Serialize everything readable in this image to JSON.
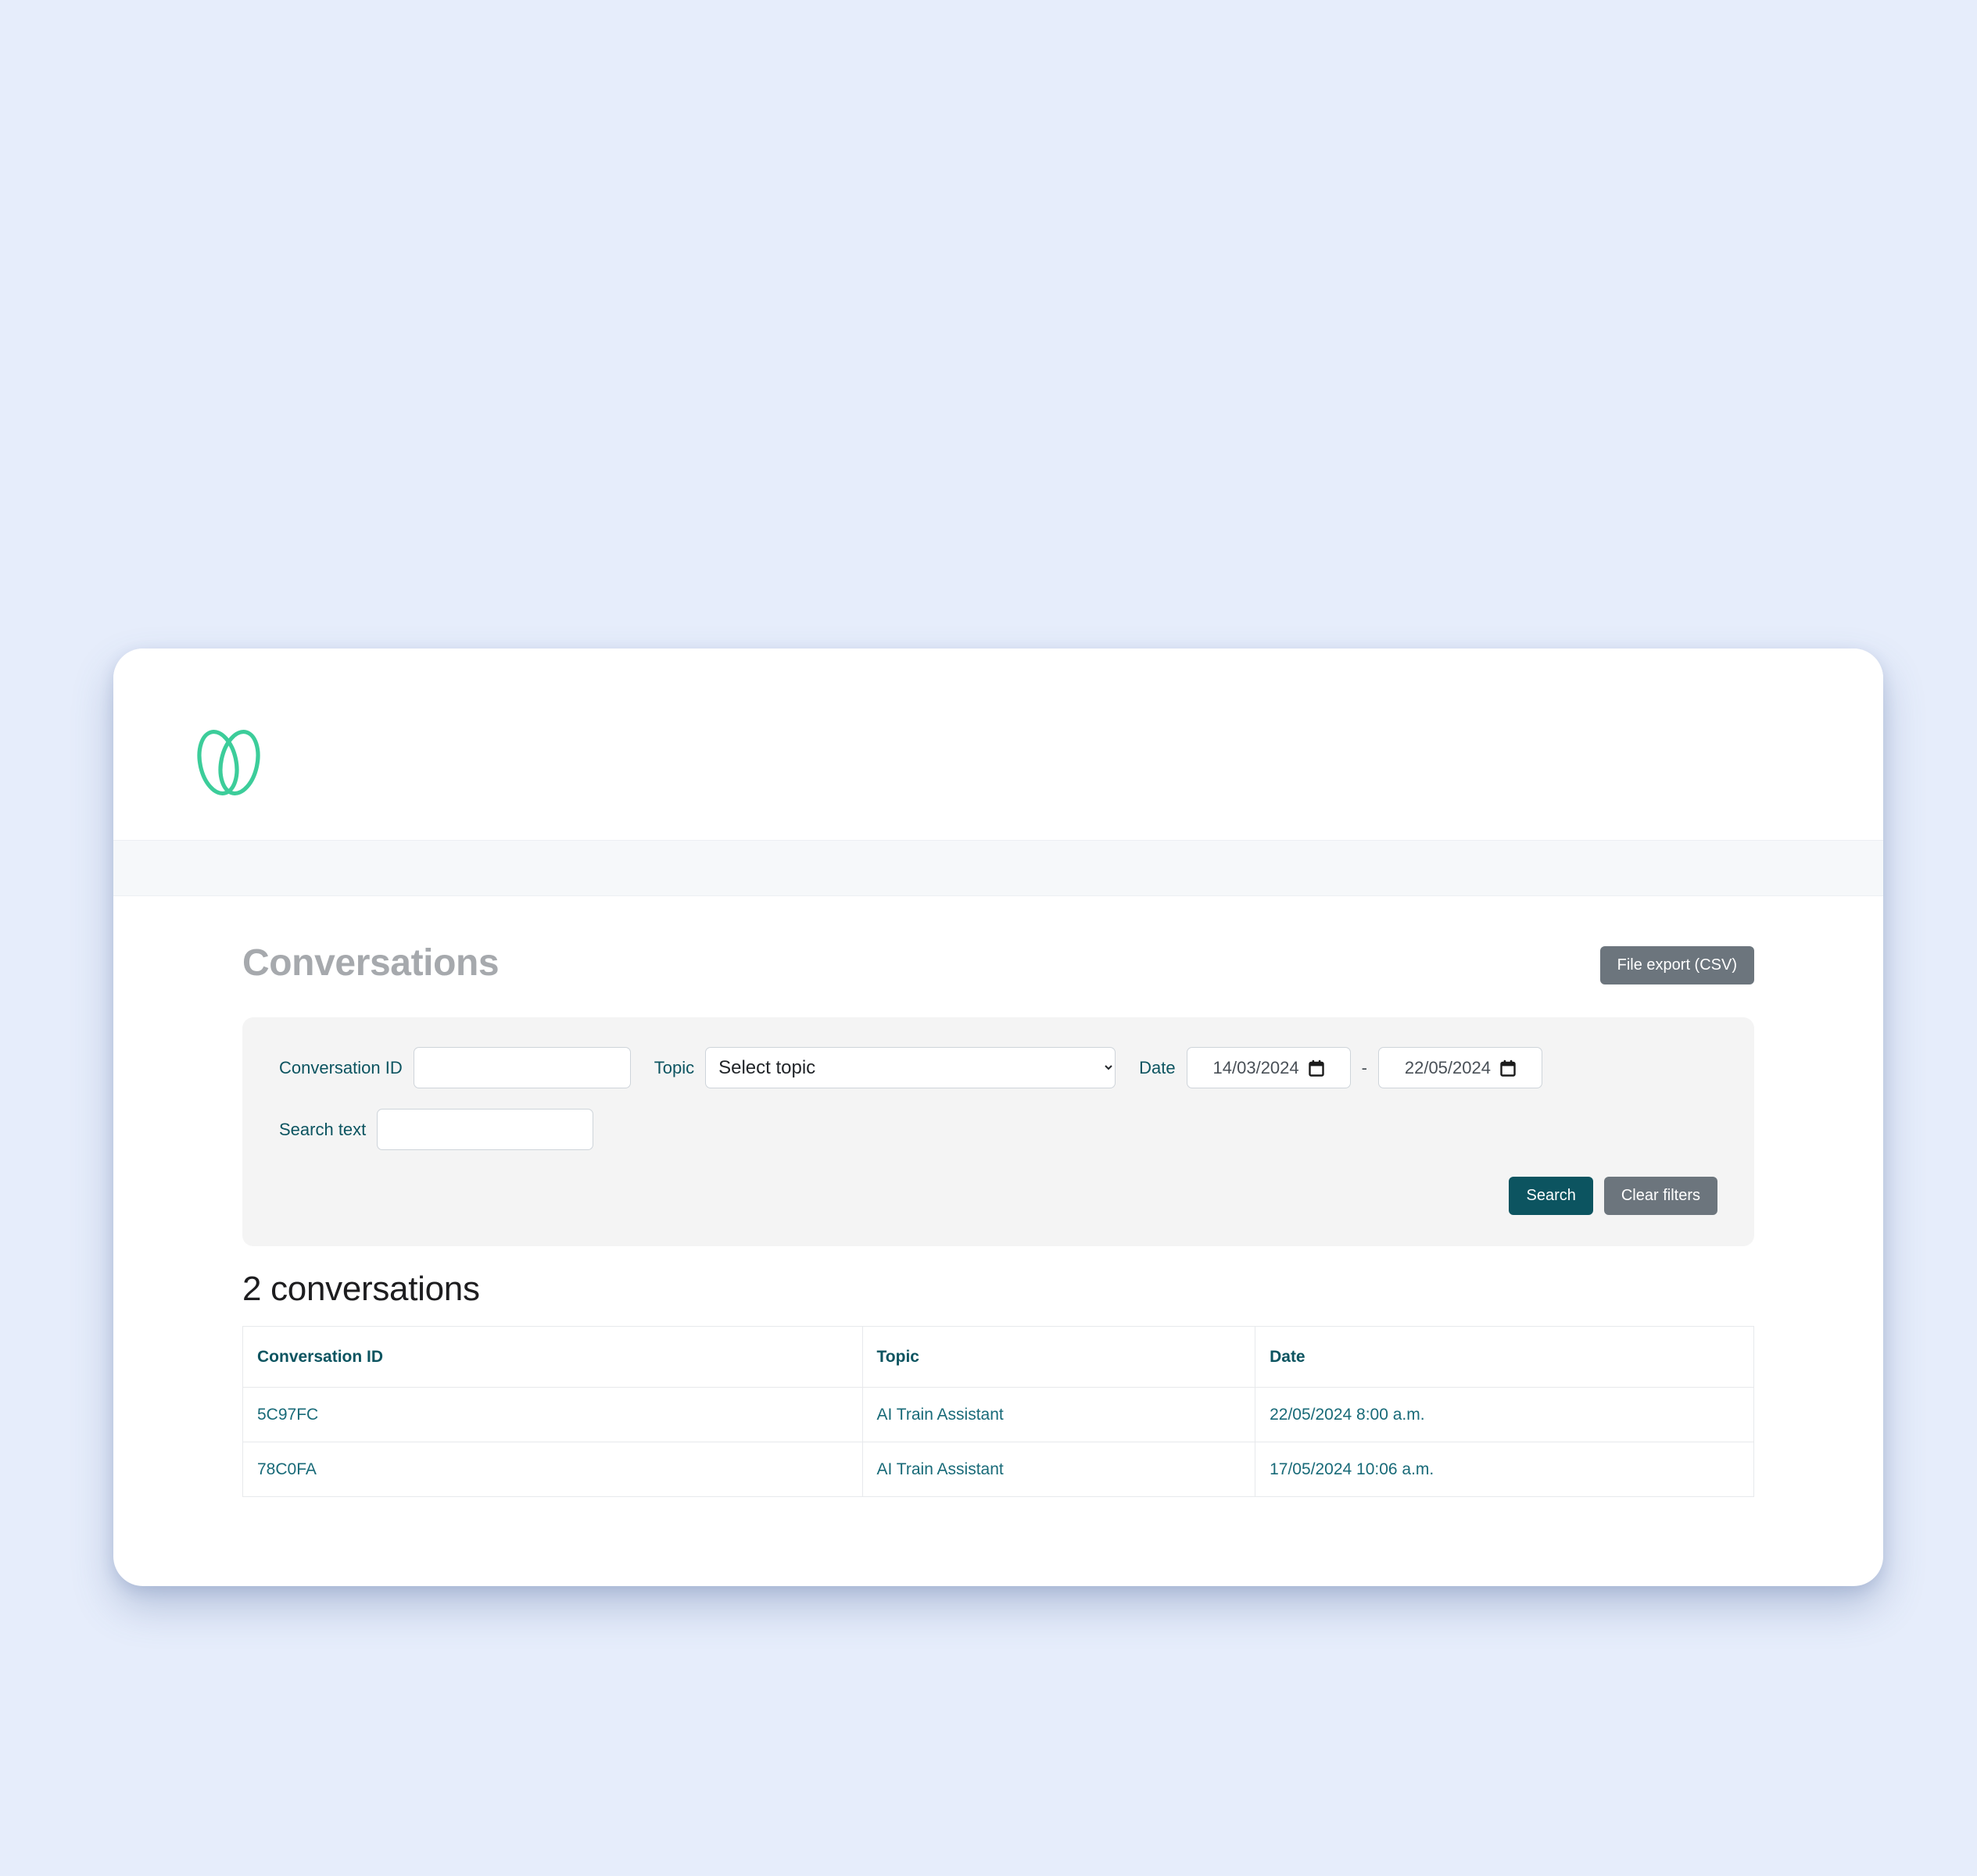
{
  "theme": {
    "page_background": "#e6edfb",
    "card_background": "#ffffff",
    "brand_green": "#3ccd9a",
    "accent_teal": "#0c5460",
    "secondary_gray": "#6c757d",
    "title_gray": "#a6a9ad",
    "panel_gray": "#f4f4f4",
    "navstrip_gray": "#f6f8fa"
  },
  "brand": {
    "logo_name": "double-loop-logo"
  },
  "page": {
    "title": "Conversations",
    "export_button": "File export (CSV)"
  },
  "filters": {
    "conversation_id": {
      "label": "Conversation ID",
      "value": "",
      "placeholder": ""
    },
    "topic": {
      "label": "Topic",
      "selected": "Select topic",
      "options": [
        "Select topic"
      ]
    },
    "date": {
      "label": "Date",
      "from": "14/03/2024",
      "to": "22/05/2024",
      "separator": "-"
    },
    "search_text": {
      "label": "Search text",
      "value": "",
      "placeholder": ""
    },
    "search_button": "Search",
    "clear_button": "Clear filters"
  },
  "results": {
    "count_label": "2 conversations",
    "columns": [
      "Conversation ID",
      "Topic",
      "Date"
    ],
    "rows": [
      {
        "id": "5C97FC",
        "topic": "AI Train Assistant",
        "date": "22/05/2024 8:00 a.m."
      },
      {
        "id": "78C0FA",
        "topic": "AI Train Assistant",
        "date": "17/05/2024 10:06 a.m."
      }
    ]
  }
}
